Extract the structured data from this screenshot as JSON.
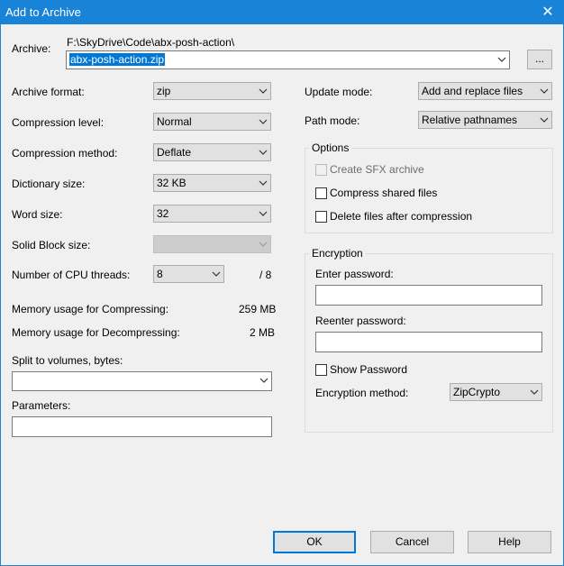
{
  "window": {
    "title": "Add to Archive",
    "close_glyph": "✕"
  },
  "archive": {
    "label": "Archive:",
    "path": "F:\\SkyDrive\\Code\\abx-posh-action\\",
    "filename": "abx-posh-action.zip",
    "browse_label": "..."
  },
  "left": {
    "archive_format": {
      "label": "Archive format:",
      "value": "zip"
    },
    "compression_level": {
      "label": "Compression level:",
      "value": "Normal"
    },
    "compression_method": {
      "label": "Compression method:",
      "value": "Deflate"
    },
    "dictionary_size": {
      "label": "Dictionary size:",
      "value": "32 KB"
    },
    "word_size": {
      "label": "Word size:",
      "value": "32"
    },
    "solid_block": {
      "label": "Solid Block size:",
      "value": ""
    },
    "cpu_threads": {
      "label": "Number of CPU threads:",
      "value": "8",
      "max": "/ 8"
    },
    "mem_compress": {
      "label": "Memory usage for Compressing:",
      "value": "259 MB"
    },
    "mem_decompress": {
      "label": "Memory usage for Decompressing:",
      "value": "2 MB"
    },
    "split": {
      "label": "Split to volumes, bytes:",
      "value": ""
    },
    "parameters": {
      "label": "Parameters:",
      "value": ""
    }
  },
  "right": {
    "update_mode": {
      "label": "Update mode:",
      "value": "Add and replace files"
    },
    "path_mode": {
      "label": "Path mode:",
      "value": "Relative pathnames"
    },
    "options": {
      "title": "Options",
      "sfx": "Create SFX archive",
      "compress_shared": "Compress shared files",
      "delete_after": "Delete files after compression"
    },
    "encryption": {
      "title": "Encryption",
      "enter_pw": "Enter password:",
      "reenter_pw": "Reenter password:",
      "show_pw": "Show Password",
      "method_label": "Encryption method:",
      "method_value": "ZipCrypto"
    }
  },
  "buttons": {
    "ok": "OK",
    "cancel": "Cancel",
    "help": "Help"
  }
}
